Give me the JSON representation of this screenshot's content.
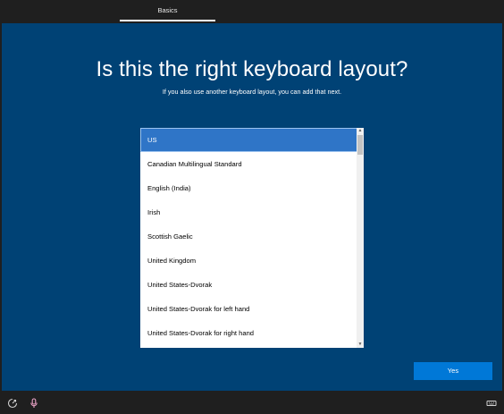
{
  "header": {
    "tab_label": "Basics"
  },
  "page": {
    "title": "Is this the right keyboard layout?",
    "subtitle": "If you also use another keyboard layout, you can add that next."
  },
  "layouts": {
    "items": [
      "US",
      "Canadian Multilingual Standard",
      "English (India)",
      "Irish",
      "Scottish Gaelic",
      "United Kingdom",
      "United States-Dvorak",
      "United States-Dvorak for left hand",
      "United States-Dvorak for right hand"
    ],
    "selected": "US"
  },
  "actions": {
    "yes_label": "Yes"
  },
  "colors": {
    "background": "#004275",
    "chrome": "#1f1f1f",
    "selection": "#2f75c7",
    "accent": "#0078d7"
  },
  "footer": {
    "icons": [
      "ease-of-access-icon",
      "microphone-icon",
      "keyboard-icon"
    ]
  }
}
